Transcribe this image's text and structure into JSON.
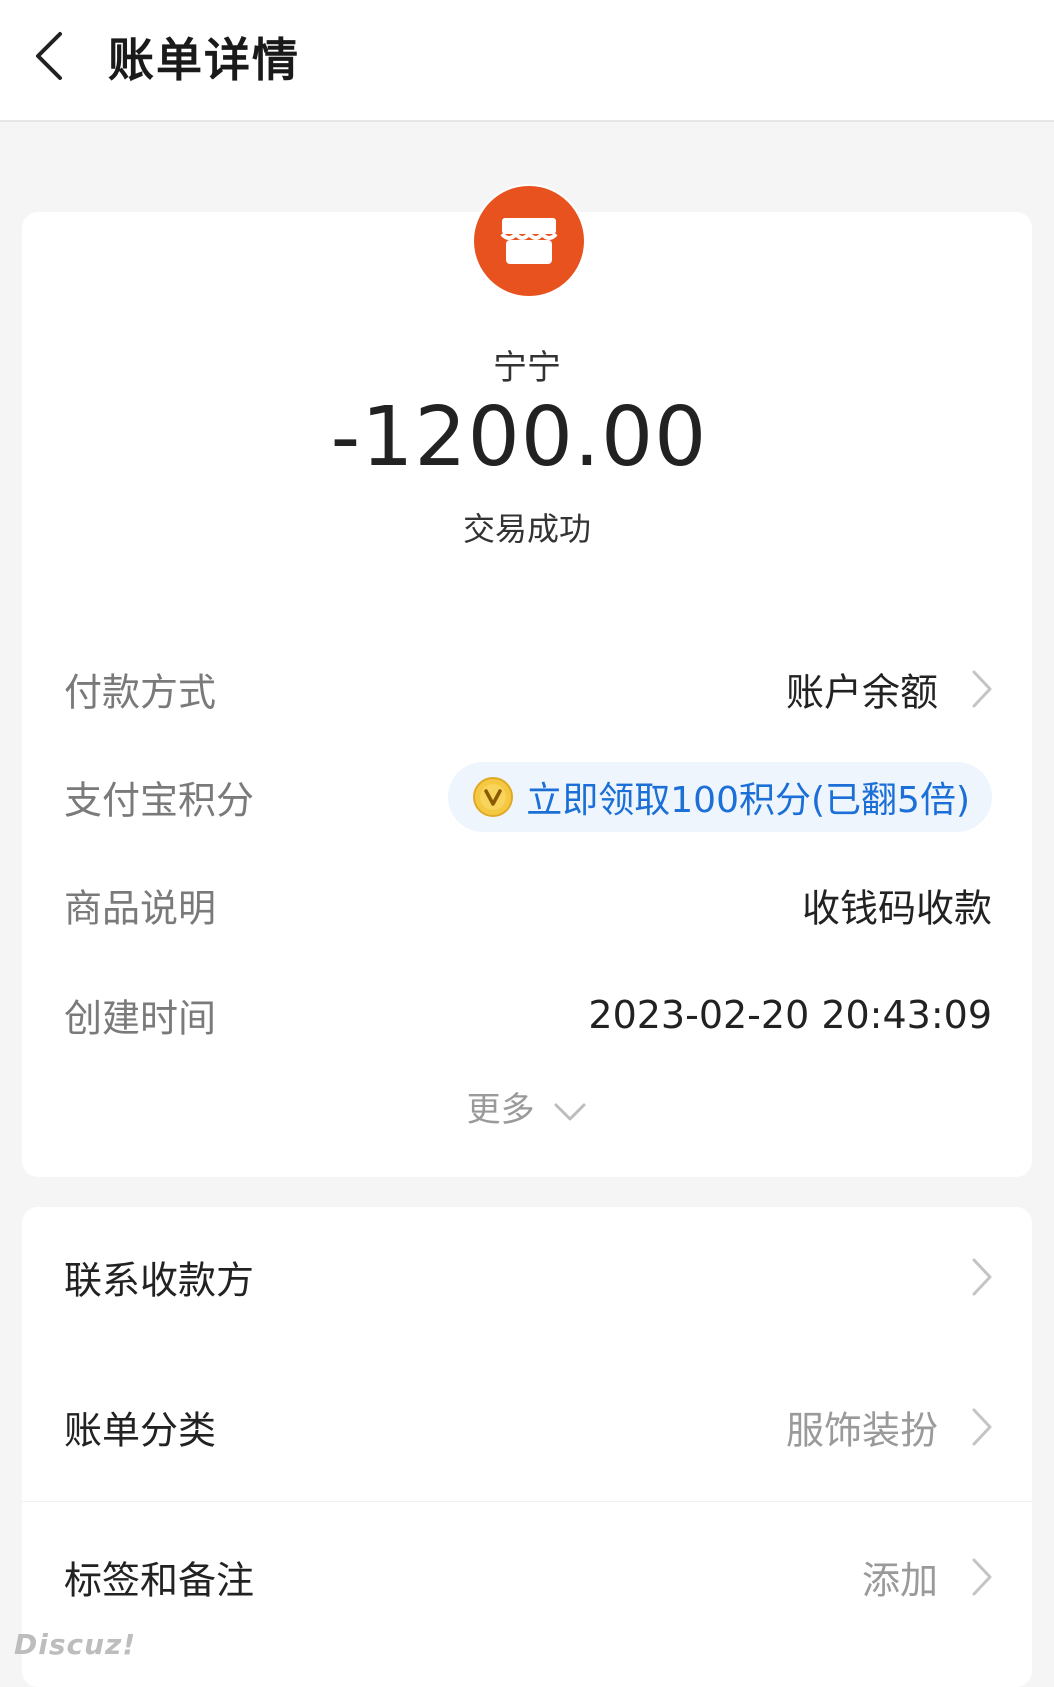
{
  "header": {
    "title": "账单详情"
  },
  "summary": {
    "payee": "宁宁",
    "amount": "-1200.00",
    "status": "交易成功"
  },
  "details": {
    "payment_method": {
      "label": "付款方式",
      "value": "账户余额"
    },
    "points": {
      "label": "支付宝积分",
      "value": "立即领取100积分(已翻5倍)"
    },
    "product": {
      "label": "商品说明",
      "value": "收钱码收款"
    },
    "created": {
      "label": "创建时间",
      "value": "2023-02-20 20:43:09"
    },
    "more_label": "更多"
  },
  "actions": {
    "contact": {
      "label": "联系收款方"
    },
    "category": {
      "label": "账单分类",
      "value": "服饰装扮"
    },
    "tags": {
      "label": "标签和备注",
      "value": "添加"
    }
  },
  "watermark": "Discuz!",
  "colors": {
    "merchant_icon_bg": "#e8521f",
    "points_pill_bg": "#eef5fd",
    "points_text": "#1b6fd6",
    "coin": "#f5c842"
  }
}
